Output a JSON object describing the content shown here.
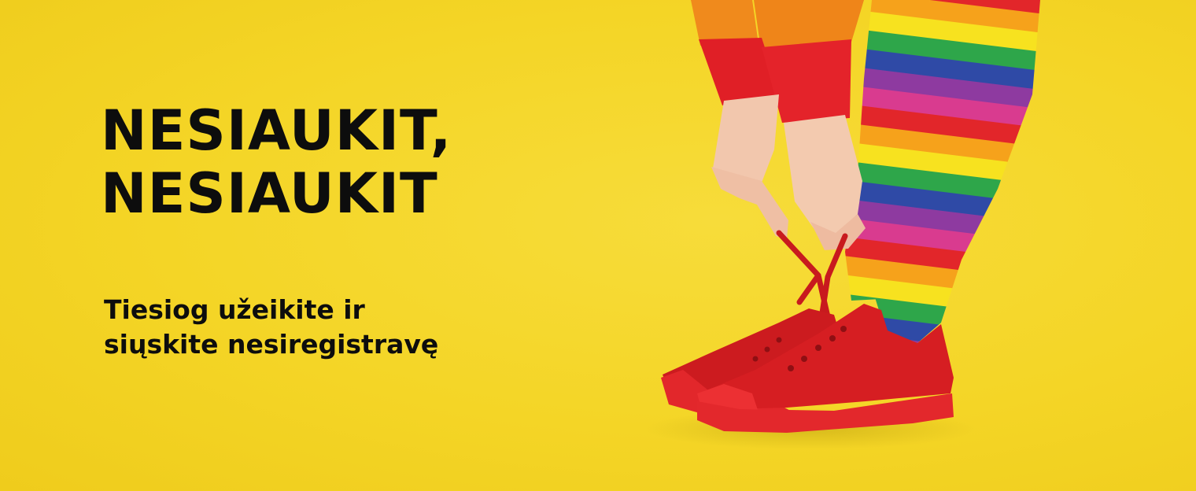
{
  "banner": {
    "headline_line1": "NESIAUKIT,",
    "headline_line2": "NESIAUKIT",
    "subline_line1": "Tiesiog užeikite ir",
    "subline_line2": "siųskite nesiregistravę"
  },
  "colors": {
    "background": "#f4d526",
    "text": "#0d0d0d",
    "shoe": "#d51d21"
  }
}
